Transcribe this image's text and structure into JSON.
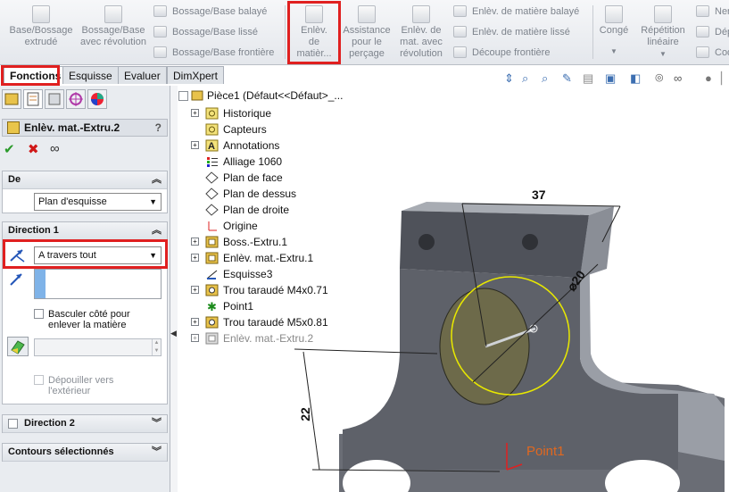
{
  "ribbon": {
    "extrude_boss": "Base/Bossage extrudé",
    "revolve_boss": "Bossage/Base avec révolution",
    "swept_boss": "Bossage/Base balayé",
    "loft_boss": "Bossage/Base lissé",
    "boundary_boss": "Bossage/Base frontière",
    "extruded_cut": "Enlèv. de matièr...",
    "hole_wizard": "Assistance pour le perçage",
    "revolved_cut": "Enlèv. de mat. avec révolution",
    "swept_cut": "Enlèv. de matière balayé",
    "lofted_cut": "Enlèv. de matière lissé",
    "boundary_cut": "Découpe frontière",
    "fillet": "Congé",
    "linear_pattern": "Répétition linéaire",
    "rib": "Ner",
    "draft": "Dép",
    "shell": "Coq"
  },
  "tabs": [
    "Fonctions",
    "Esquisse",
    "Evaluer",
    "DimXpert"
  ],
  "panel": {
    "feature_name": "Enlèv. mat.-Extru.2",
    "help": "?",
    "ok": "✔",
    "cancel": "✖",
    "preview": "∞",
    "from_section": "De",
    "from_value": "Plan d'esquisse",
    "direction1": "Direction 1",
    "end_condition": "A travers tout",
    "flip_side": "Basculer côté pour enlever la matière",
    "draft_outward": "Dépouiller vers l'extérieur",
    "direction2": "Direction 2",
    "selected_contours": "Contours sélectionnés"
  },
  "tree": {
    "root": "Pièce1  (Défaut<<Défaut>_...",
    "items": [
      {
        "label": "Historique",
        "plus": true
      },
      {
        "label": "Capteurs",
        "plus": false
      },
      {
        "label": "Annotations",
        "plus": true
      },
      {
        "label": "Alliage 1060",
        "plus": false
      },
      {
        "label": "Plan de face",
        "plus": false
      },
      {
        "label": "Plan de dessus",
        "plus": false
      },
      {
        "label": "Plan de droite",
        "plus": false
      },
      {
        "label": "Origine",
        "plus": false
      },
      {
        "label": "Boss.-Extru.1",
        "plus": true
      },
      {
        "label": "Enlèv. mat.-Extru.1",
        "plus": true
      },
      {
        "label": "Esquisse3",
        "plus": false
      },
      {
        "label": "Trou taraudé M4x0.71",
        "plus": true
      },
      {
        "label": "Point1",
        "plus": false
      },
      {
        "label": "Trou taraudé M5x0.81",
        "plus": true
      },
      {
        "label": "Enlèv. mat.-Extru.2",
        "plus": true
      }
    ]
  },
  "model": {
    "dim_width": "37",
    "dim_diameter": "⌀20",
    "dim_height": "22",
    "point_label": "Point1"
  },
  "colors": {
    "highlight": "#e02020",
    "part": "#5e6169",
    "part_light": "#8f939b",
    "circle_fill": "#6d6a4a",
    "circle_edge": "#e8e800"
  }
}
